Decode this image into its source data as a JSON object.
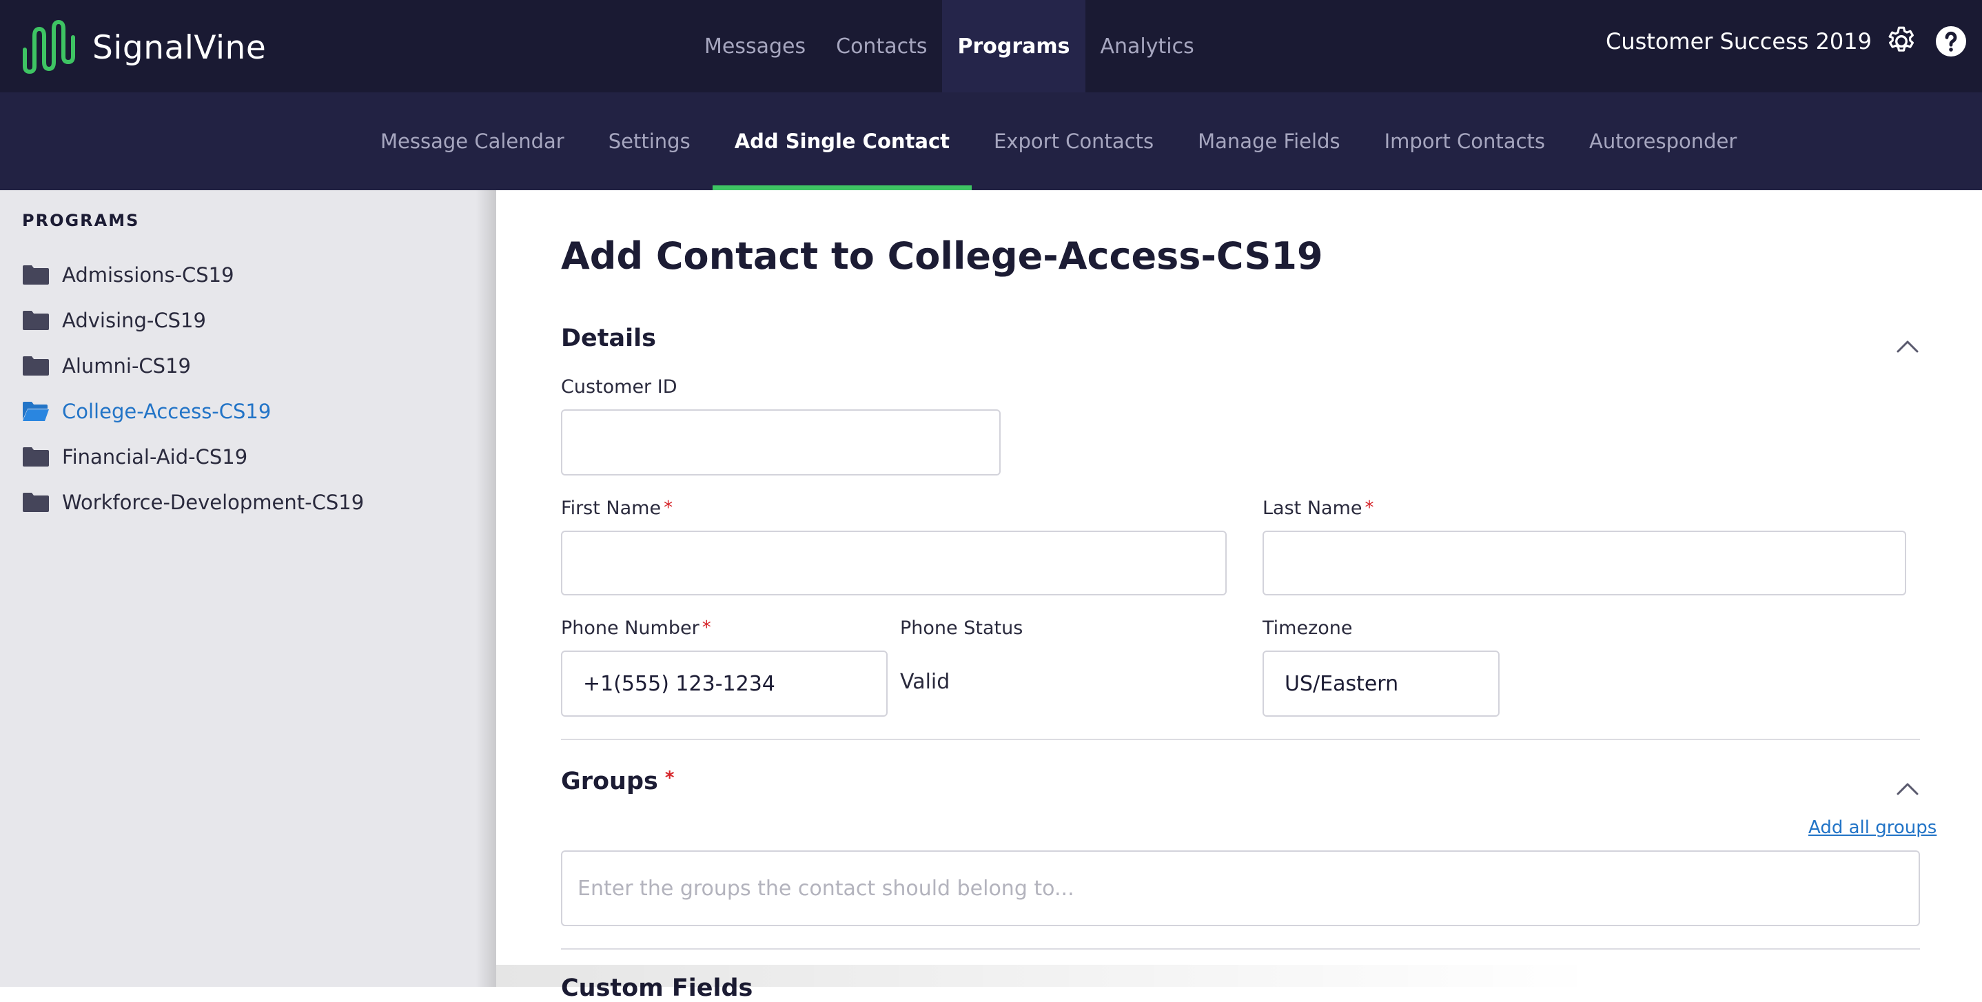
{
  "brand": {
    "name": "SignalVine",
    "accent": "#3ec463"
  },
  "nav": {
    "items": [
      {
        "label": "Messages",
        "active": false
      },
      {
        "label": "Contacts",
        "active": false
      },
      {
        "label": "Programs",
        "active": true
      },
      {
        "label": "Analytics",
        "active": false
      }
    ]
  },
  "account": {
    "name": "Customer Success 2019",
    "settings_icon": "gear-icon",
    "help_icon": "help-icon"
  },
  "subnav": {
    "items": [
      {
        "label": "Message Calendar",
        "active": false
      },
      {
        "label": "Settings",
        "active": false
      },
      {
        "label": "Add Single Contact",
        "active": true
      },
      {
        "label": "Export Contacts",
        "active": false
      },
      {
        "label": "Manage Fields",
        "active": false
      },
      {
        "label": "Import Contacts",
        "active": false
      },
      {
        "label": "Autoresponder",
        "active": false
      }
    ]
  },
  "sidebar": {
    "heading": "PROGRAMS",
    "items": [
      {
        "label": "Admissions-CS19",
        "active": false
      },
      {
        "label": "Advising-CS19",
        "active": false
      },
      {
        "label": "Alumni-CS19",
        "active": false
      },
      {
        "label": "College-Access-CS19",
        "active": true
      },
      {
        "label": "Financial-Aid-CS19",
        "active": false
      },
      {
        "label": "Workforce-Development-CS19",
        "active": false
      }
    ]
  },
  "form": {
    "title": "Add Contact to College-Access-CS19",
    "details": {
      "title": "Details",
      "customer_id": {
        "label": "Customer ID",
        "value": ""
      },
      "first_name": {
        "label": "First Name",
        "value": "",
        "required": "*"
      },
      "last_name": {
        "label": "Last Name",
        "value": "",
        "required": "*"
      },
      "phone_number": {
        "label": "Phone Number",
        "value": "+1(555) 123-1234",
        "required": "*"
      },
      "phone_status": {
        "label": "Phone Status",
        "value": "Valid"
      },
      "timezone": {
        "label": "Timezone",
        "value": "US/Eastern"
      }
    },
    "groups": {
      "title": "Groups",
      "required": "*",
      "add_all_label": "Add all groups",
      "placeholder": "Enter the groups the contact should belong to..."
    },
    "custom_fields": {
      "title": "Custom Fields"
    }
  },
  "colors": {
    "topbar": "#1a1a33",
    "subbar": "#222243",
    "link": "#2274c7",
    "required": "#d6262b"
  }
}
